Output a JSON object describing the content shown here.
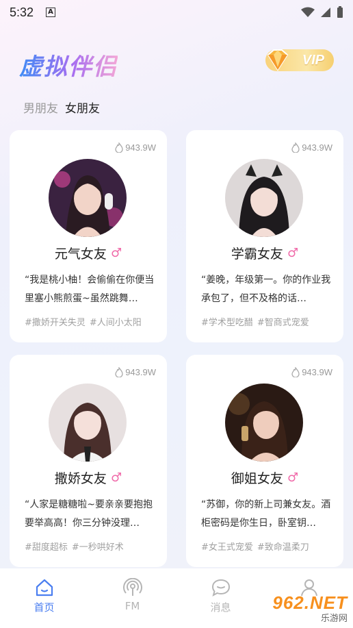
{
  "status_bar": {
    "time": "5:32",
    "a_label": "A"
  },
  "header": {
    "title": "虚拟伴侣",
    "vip_label": "VIP"
  },
  "tabs": [
    {
      "label": "男朋友",
      "active": false
    },
    {
      "label": "女朋友",
      "active": true
    }
  ],
  "cards": [
    {
      "heat": "943.9W",
      "name": "元气女友",
      "gender_symbol": "♂",
      "desc": "“我是桃小柚！会偷偷在你便当里塞小熊煎蛋~虽然跳舞…",
      "tags": [
        "#撒娇开关失灵",
        "#人间小太阳"
      ]
    },
    {
      "heat": "943.9W",
      "name": "学霸女友",
      "gender_symbol": "♂",
      "desc": "“姜晚，年级第一。你的作业我承包了，但不及格的话…",
      "tags": [
        "#学术型吃醋",
        "#智商式宠爱"
      ]
    },
    {
      "heat": "943.9W",
      "name": "撒娇女友",
      "gender_symbol": "♂",
      "desc": "“人家是糖糖啦~要亲亲要抱抱要举高高！你三分钟没理…",
      "tags": [
        "#甜度超标",
        "#一秒哄好术"
      ]
    },
    {
      "heat": "943.9W",
      "name": "御姐女友",
      "gender_symbol": "♂",
      "desc": "“苏御，你的新上司兼女友。酒柜密码是你生日，卧室钥…",
      "tags": [
        "#女王式宠爱",
        "#致命温柔刀"
      ]
    }
  ],
  "bottom_nav": [
    {
      "label": "首页",
      "icon": "home-icon",
      "active": true
    },
    {
      "label": "FM",
      "icon": "radio-icon",
      "active": false
    },
    {
      "label": "消息",
      "icon": "message-icon",
      "active": false
    },
    {
      "label": "",
      "icon": "profile-icon",
      "active": false
    }
  ],
  "watermark": {
    "big": "962.NET",
    "small": "乐游网"
  },
  "colors": {
    "accent": "#4a7ef0",
    "gender": "#f06aa9",
    "vip": "#f6cf70"
  }
}
